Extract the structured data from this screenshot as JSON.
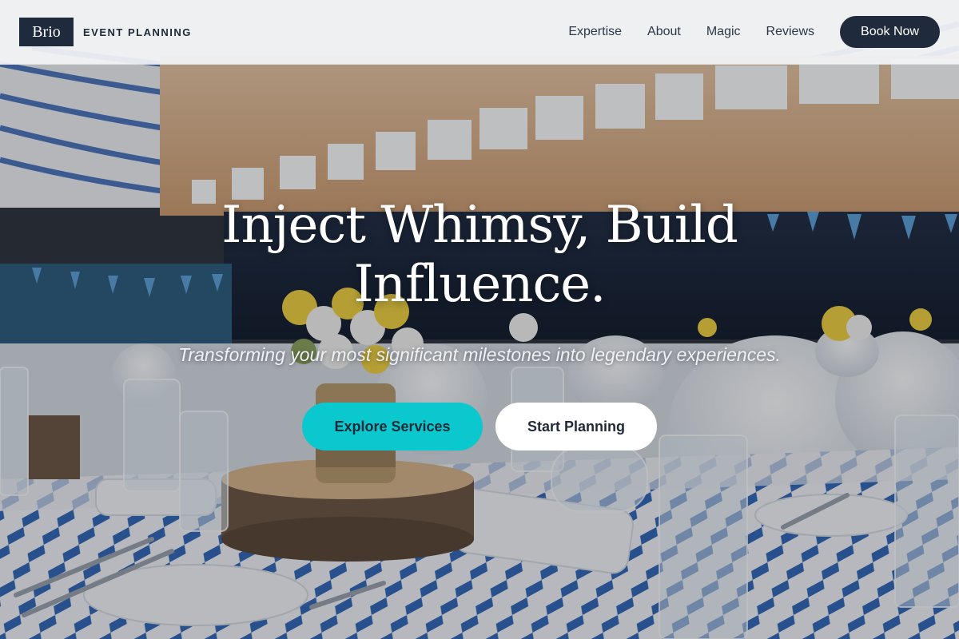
{
  "header": {
    "logo_text": "Brio",
    "tagline": "EVENT PLANNING",
    "nav": [
      {
        "label": "Expertise"
      },
      {
        "label": "About"
      },
      {
        "label": "Magic"
      },
      {
        "label": "Reviews"
      }
    ],
    "book_label": "Book Now"
  },
  "hero": {
    "headline": "Inject Whimsy, Build Influence.",
    "subhead": "Transforming your most significant milestones into legendary experiences.",
    "primary_cta": "Explore Services",
    "secondary_cta": "Start Planning",
    "background_image": "event-hall-table-setting"
  },
  "colors": {
    "brand_dark": "#1f2a3c",
    "accent": "#0bc8cf",
    "header_bg": "#f3f4f6"
  }
}
